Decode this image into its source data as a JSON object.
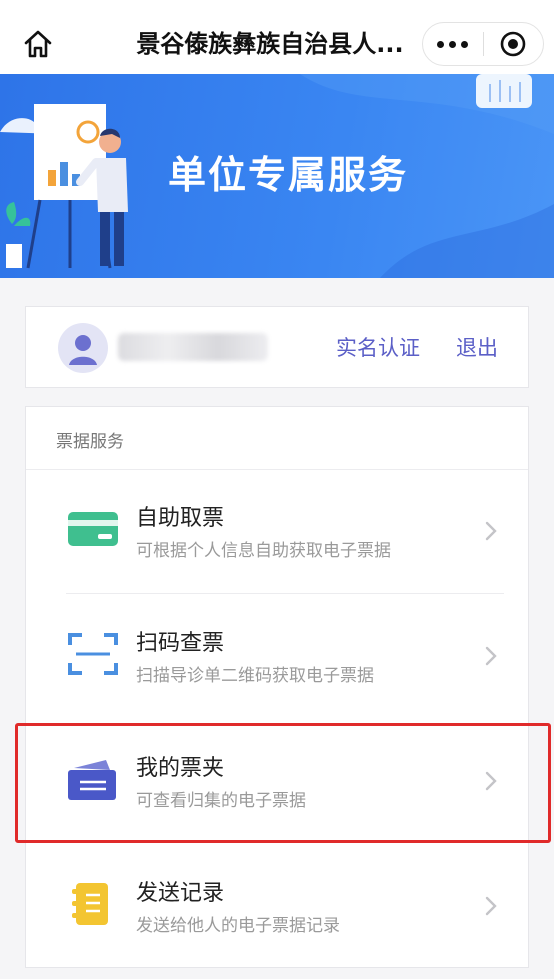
{
  "nav": {
    "title": "景谷傣族彝族自治县人..."
  },
  "banner": {
    "title": "单位专属服务"
  },
  "user": {
    "verify_label": "实名认证",
    "logout_label": "退出"
  },
  "services": {
    "section_label": "票据服务",
    "items": [
      {
        "title": "自助取票",
        "subtitle": "可根据个人信息自助获取电子票据",
        "icon": "ticket-card-icon",
        "color": "#3fbf8f"
      },
      {
        "title": "扫码查票",
        "subtitle": "扫描导诊单二维码获取电子票据",
        "icon": "scan-icon",
        "color": "#4a8fe0"
      },
      {
        "title": "我的票夹",
        "subtitle": "可查看归集的电子票据",
        "icon": "folder-icon",
        "color": "#4a58c8"
      },
      {
        "title": "发送记录",
        "subtitle": "发送给他人的电子票据记录",
        "icon": "notebook-icon",
        "color": "#f3c531"
      }
    ]
  },
  "colors": {
    "banner": "#3a86f2",
    "link": "#5b5fc7",
    "highlight": "#e02a2a"
  }
}
